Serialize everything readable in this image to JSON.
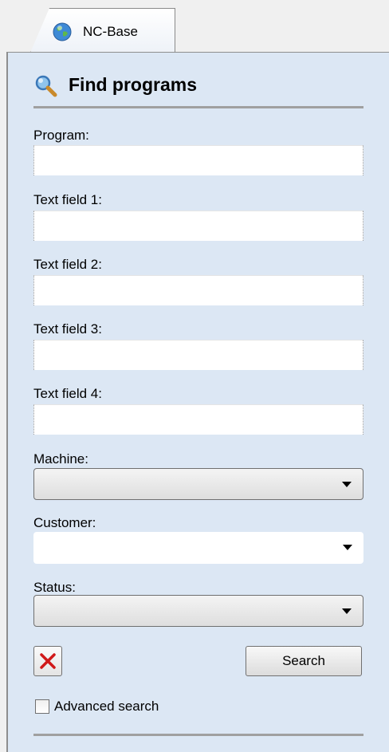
{
  "tab": {
    "label": "NC-Base",
    "icon": "globe-icon"
  },
  "header": {
    "title": "Find programs",
    "icon": "magnifier-icon"
  },
  "fields": {
    "program": {
      "label": "Program:",
      "value": ""
    },
    "text1": {
      "label": "Text field 1:",
      "value": ""
    },
    "text2": {
      "label": "Text field 2:",
      "value": ""
    },
    "text3": {
      "label": "Text field 3:",
      "value": ""
    },
    "text4": {
      "label": "Text field 4:",
      "value": ""
    }
  },
  "dropdowns": {
    "machine": {
      "label": "Machine:",
      "selected": ""
    },
    "customer": {
      "label": "Customer:",
      "selected": ""
    },
    "status": {
      "label": "Status:",
      "selected": ""
    }
  },
  "actions": {
    "clear_icon": "close-icon",
    "search_label": "Search"
  },
  "advanced": {
    "label": "Advanced search",
    "checked": false
  },
  "colors": {
    "panel_bg": "#dce7f4",
    "clear_icon": "#d01818"
  }
}
